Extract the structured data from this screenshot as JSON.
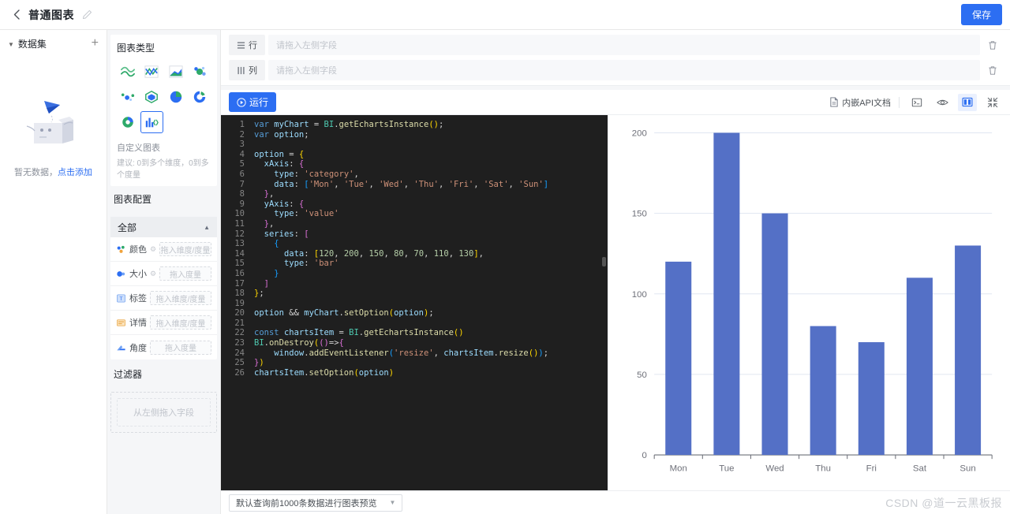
{
  "topbar": {
    "back_icon": "chevron-left-icon",
    "title": "普通图表",
    "edit_icon": "edit-pencil-icon",
    "save_label": "保存"
  },
  "dataset_panel": {
    "title": "数据集",
    "add_icon": "plus-icon",
    "empty_text": "暂无数据，",
    "empty_link": "点击添加"
  },
  "chart_type_panel": {
    "title": "图表类型",
    "items": [
      {
        "name": "smooth-line-chart-icon",
        "active": false
      },
      {
        "name": "line-chart-icon",
        "active": false
      },
      {
        "name": "area-chart-icon",
        "active": false
      },
      {
        "name": "scatter-bubble-chart-icon",
        "active": false
      },
      {
        "name": "scatter-chart-icon",
        "active": false
      },
      {
        "name": "radar-chart-icon",
        "active": false
      },
      {
        "name": "pie-chart-icon",
        "active": false
      },
      {
        "name": "donut-chart-icon",
        "active": false
      },
      {
        "name": "ring-chart-icon",
        "active": false
      },
      {
        "name": "custom-chart-icon",
        "active": true
      }
    ],
    "hint_title": "自定义图表",
    "hint_sub": "建议: 0到多个维度，0到多个度量"
  },
  "chart_config_panel": {
    "title": "图表配置",
    "group_label": "全部",
    "collapse_icon": "triangle-up-icon",
    "rows": [
      {
        "icon": "color-icon",
        "label": "颜色",
        "gear": true,
        "placeholder": "拖入维度/度量"
      },
      {
        "icon": "size-icon",
        "label": "大小",
        "gear": true,
        "placeholder": "拖入度量"
      },
      {
        "icon": "label-icon",
        "label": "标签",
        "gear": false,
        "placeholder": "拖入维度/度量"
      },
      {
        "icon": "detail-icon",
        "label": "详情",
        "gear": false,
        "placeholder": "拖入维度/度量"
      },
      {
        "icon": "angle-icon",
        "label": "角度",
        "gear": false,
        "placeholder": "拖入度量"
      }
    ]
  },
  "filter_panel": {
    "title": "过滤器",
    "placeholder": "从左侧拖入字段"
  },
  "shelves": [
    {
      "icon": "rows-icon",
      "label": "行",
      "placeholder": "请拖入左侧字段",
      "value": "",
      "delete_icon": "trash-icon"
    },
    {
      "icon": "columns-icon",
      "label": "列",
      "placeholder": "请拖入左侧字段",
      "value": "",
      "delete_icon": "trash-icon"
    }
  ],
  "editor_toolbar": {
    "run_label": "运行",
    "run_icon": "play-circle-icon",
    "api_doc_label": "内嵌API文档",
    "api_doc_icon": "file-doc-icon",
    "icons": [
      {
        "name": "console-icon",
        "active": false
      },
      {
        "name": "eye-preview-icon",
        "active": false
      },
      {
        "name": "split-layout-icon",
        "active": true
      },
      {
        "name": "collapse-fullscreen-icon",
        "active": false
      }
    ]
  },
  "code": {
    "language": "javascript",
    "lines": [
      "var myChart = BI.getEchartsInstance();",
      "var option;",
      "",
      "option = {",
      "  xAxis: {",
      "    type: 'category',",
      "    data: ['Mon', 'Tue', 'Wed', 'Thu', 'Fri', 'Sat', 'Sun']",
      "  },",
      "  yAxis: {",
      "    type: 'value'",
      "  },",
      "  series: [",
      "    {",
      "      data: [120, 200, 150, 80, 70, 110, 130],",
      "      type: 'bar'",
      "    }",
      "  ]",
      "};",
      "",
      "option && myChart.setOption(option);",
      "",
      "const chartsItem = BI.getEchartsInstance()",
      "BI.onDestroy(()=>{",
      "    window.addEventListener('resize', chartsItem.resize());",
      "})",
      "chartsItem.setOption(option)"
    ]
  },
  "chart_data": {
    "type": "bar",
    "categories": [
      "Mon",
      "Tue",
      "Wed",
      "Thu",
      "Fri",
      "Sat",
      "Sun"
    ],
    "values": [
      120,
      200,
      150,
      80,
      70,
      110,
      130
    ],
    "title": "",
    "xlabel": "",
    "ylabel": "",
    "ylim": [
      0,
      200
    ],
    "yticks": [
      0,
      50,
      100,
      150,
      200
    ],
    "grid": true,
    "legend": "none",
    "bar_color": "#5470c6",
    "axis_color": "#6e7079",
    "grid_color": "#e0e6f1"
  },
  "bottombar": {
    "limit_label": "默认查询前1000条数据进行图表预览",
    "chevron_icon": "chevron-down-icon",
    "watermark": "CSDN @道一云黑板报"
  }
}
